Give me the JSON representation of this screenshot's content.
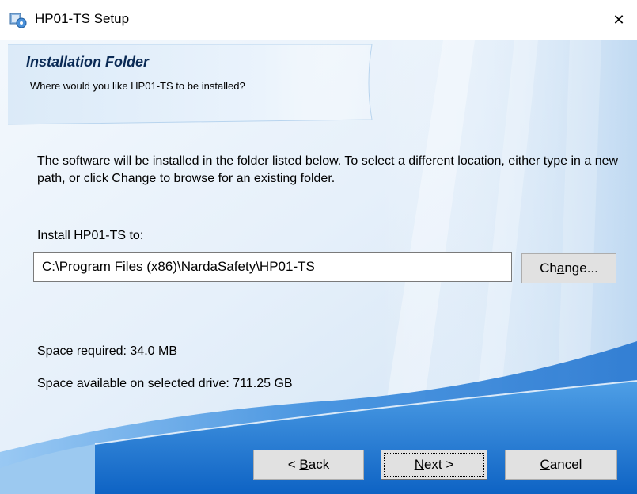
{
  "window": {
    "title": "HP01-TS Setup",
    "close_glyph": "✕"
  },
  "header": {
    "title": "Installation Folder",
    "subtitle": "Where would you like HP01-TS  to be installed?"
  },
  "description": "The software will be installed in the folder listed below. To select a different location, either type in a new path, or click Change to browse for an existing folder.",
  "install": {
    "label": "Install HP01-TS to:",
    "path_value": "C:\\Program Files (x86)\\NardaSafety\\HP01-TS",
    "change_label_pre": "Ch",
    "change_label_mnemonic": "a",
    "change_label_post": "nge..."
  },
  "space": {
    "required": "Space required: 34.0 MB",
    "available": "Space available on selected drive: 711.25 GB"
  },
  "buttons": {
    "back_pre": "< ",
    "back_mnemonic": "B",
    "back_post": "ack",
    "next_mnemonic": "N",
    "next_post": "ext >",
    "cancel_mnemonic": "C",
    "cancel_post": "ancel"
  },
  "icons": {
    "app": "setup-installer-icon",
    "close": "close-icon"
  },
  "colors": {
    "accent_blue": "#1e78d2",
    "header_title": "#0a2a55",
    "button_face": "#e1e1e1"
  }
}
